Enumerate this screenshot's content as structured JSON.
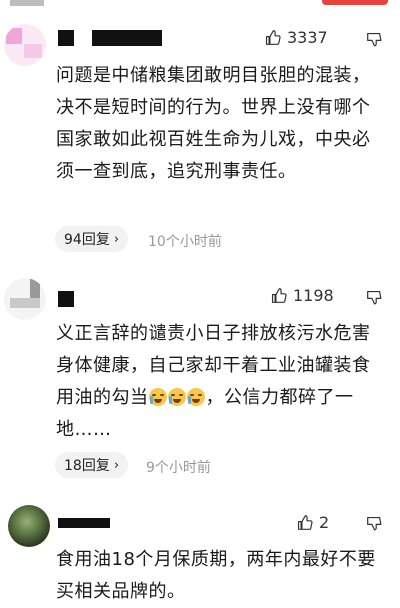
{
  "colors": {
    "accent_red": "#e8443c",
    "text": "#1a1a1a",
    "muted": "#9a9a9a",
    "pill_bg": "#f2f2f2"
  },
  "comments": [
    {
      "likes": "3337",
      "text": "问题是中储粮集团敢明目张胆的混装，决不是短时间的行为。世界上没有哪个国家敢如此视百姓生命为儿戏，中央必须一查到底，追究刑事责任。",
      "reply_label": "94回复",
      "time": "10个小时前"
    },
    {
      "likes": "1198",
      "text_before_emoji": "义正言辞的谴责小日子排放核污水危害身体健康，自己家却干着工业油罐装食用油的勾当",
      "text_after_emoji": "，公信力都碎了一地……",
      "emoji_name": "crying-laugh-emoji",
      "reply_label": "18回复",
      "time": "9个小时前"
    },
    {
      "likes": "2",
      "text": "食用油18个月保质期，两年内最好不要买相关品牌的。"
    }
  ]
}
